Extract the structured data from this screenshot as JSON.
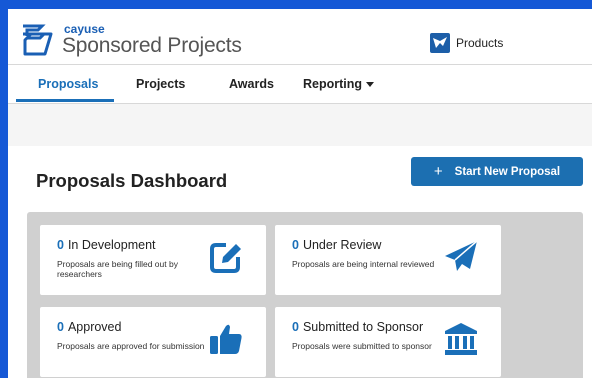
{
  "header": {
    "brand_small": "cayuse",
    "brand_big": "Sponsored Projects",
    "products_label": "Products"
  },
  "nav": {
    "tabs": [
      {
        "label": "Proposals",
        "active": true
      },
      {
        "label": "Projects"
      },
      {
        "label": "Awards"
      },
      {
        "label": "Reporting"
      }
    ]
  },
  "dashboard": {
    "title": "Proposals Dashboard",
    "start_button_plus": "+",
    "start_button_label": "Start New Proposal",
    "cards": [
      {
        "count": "0",
        "label": "In Development",
        "desc": "Proposals are being filled out by researchers",
        "icon": "edit-icon"
      },
      {
        "count": "0",
        "label": "Under Review",
        "desc": "Proposals are being internal reviewed",
        "icon": "paper-plane-icon"
      },
      {
        "count": "0",
        "label": "Approved",
        "desc": "Proposals are approved for submission",
        "icon": "thumbs-up-icon"
      },
      {
        "count": "0",
        "label": "Submitted to Sponsor",
        "desc": "Proposals were submitted to sponsor",
        "icon": "bank-icon"
      }
    ]
  },
  "colors": {
    "accent": "#1a6fb8",
    "button": "#1c6fb1",
    "frame": "#1558d6",
    "panel": "#d0d0d0"
  }
}
